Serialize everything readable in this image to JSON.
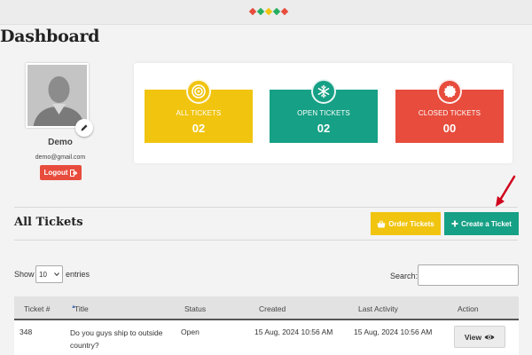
{
  "header": {
    "title": "Dashboard"
  },
  "loader_colors": [
    "#e74c3c",
    "#27ae60",
    "#f1c40f",
    "#27ae60",
    "#e74c3c"
  ],
  "profile": {
    "name": "Demo",
    "email": "demo@gmail.com",
    "logout_label": "Logout",
    "avatar_icon": "user-silhouette-icon",
    "edit_icon": "pencil-icon",
    "logout_icon": "sign-out-icon"
  },
  "stats": [
    {
      "label": "ALL TICKETS",
      "value": "02",
      "color": "#f1c40f",
      "icon": "target-icon"
    },
    {
      "label": "OPEN TICKETS",
      "value": "02",
      "color": "#16a085",
      "icon": "snowflake-icon"
    },
    {
      "label": "CLOSED TICKETS",
      "value": "00",
      "color": "#e74c3c",
      "icon": "badge-icon"
    }
  ],
  "tickets_section": {
    "title": "All Tickets",
    "order_button": "Order Tickets",
    "create_button": "Create a Ticket",
    "order_color": "#f1c40f",
    "create_color": "#16a085",
    "annotation_color": "#d0021b"
  },
  "table_controls": {
    "show_label": "Show",
    "entries_value": "10",
    "entries_label": "entries",
    "search_label": "Search:",
    "search_value": ""
  },
  "table": {
    "columns": [
      "Ticket #",
      "Title",
      "Status",
      "Created",
      "Last Activity",
      "Action"
    ],
    "rows": [
      {
        "ticket": "348",
        "title": "Do you guys ship to outside country?",
        "status": "Open",
        "created": "15 Aug, 2024 10:56 AM",
        "last_activity": "15 Aug, 2024 10:56 AM",
        "action": "View"
      }
    ]
  }
}
